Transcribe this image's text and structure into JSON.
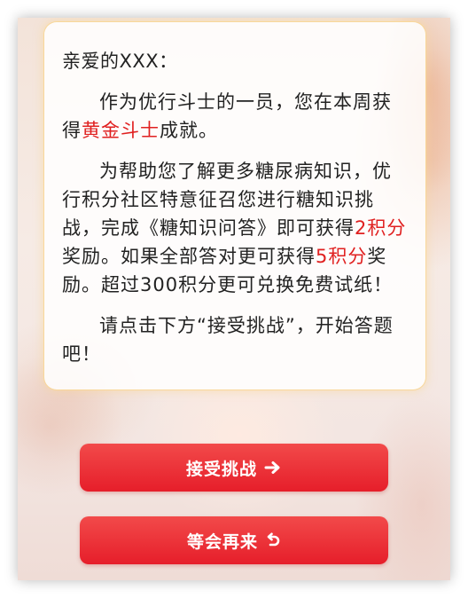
{
  "card": {
    "greeting": "亲爱的XXX：",
    "para1": {
      "text_a": "作为优行斗士的一员，您在本周获得",
      "highlight": "黄金斗士",
      "text_b": "成就。"
    },
    "para2": {
      "text_a": "为帮助您了解更多糖尿病知识，优行积分社区特意征召您进行糖知识挑战，完成《糖知识问答》即可获得",
      "highlight_1": "2积分",
      "text_b": "奖励。如果全部答对更可获得",
      "highlight_2": "5积分",
      "text_c": "奖励。超过300积分更可兑换免费试纸！"
    },
    "para3": "请点击下方“接受挑战”，开始答题吧！"
  },
  "buttons": {
    "accept_label": "接受挑战",
    "accept_icon": "arrow-right-icon",
    "later_label": "等会再来",
    "later_icon": "undo-arrow-icon"
  },
  "colors": {
    "highlight": "#e02020",
    "button": "#e8242e",
    "card_border": "#fad796"
  }
}
